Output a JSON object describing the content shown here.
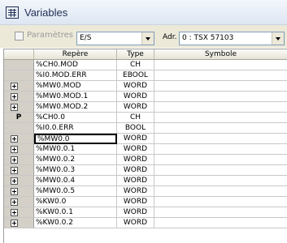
{
  "window": {
    "title": "Variables",
    "icon": "grid-icon"
  },
  "toolbar": {
    "params_label": "Paramètres",
    "type_select": {
      "value": "E/S"
    },
    "address_label": "Adr.",
    "address_select": {
      "value": "0 : TSX 57103"
    }
  },
  "table": {
    "columns": [
      "Repère",
      "Type",
      "Symbole"
    ],
    "rows": [
      {
        "marker": "",
        "repere": "%CH0.MOD",
        "type": "CH",
        "symbole": ""
      },
      {
        "marker": "",
        "repere": "%I0.MOD.ERR",
        "type": "EBOOL",
        "symbole": ""
      },
      {
        "marker": "plus",
        "repere": "%MW0.MOD",
        "type": "WORD",
        "symbole": ""
      },
      {
        "marker": "plus",
        "repere": "%MW0.MOD.1",
        "type": "WORD",
        "symbole": ""
      },
      {
        "marker": "plus",
        "repere": "%MW0.MOD.2",
        "type": "WORD",
        "symbole": ""
      },
      {
        "marker": "P",
        "repere": "%CH0.0",
        "type": "CH",
        "symbole": ""
      },
      {
        "marker": "",
        "repere": "%I0.0.ERR",
        "type": "BOOL",
        "symbole": ""
      },
      {
        "marker": "plus",
        "repere": "%MW0.0",
        "type": "WORD",
        "symbole": "",
        "active": true
      },
      {
        "marker": "plus",
        "repere": "%MW0.0.1",
        "type": "WORD",
        "symbole": ""
      },
      {
        "marker": "plus",
        "repere": "%MW0.0.2",
        "type": "WORD",
        "symbole": ""
      },
      {
        "marker": "plus",
        "repere": "%MW0.0.3",
        "type": "WORD",
        "symbole": ""
      },
      {
        "marker": "plus",
        "repere": "%MW0.0.4",
        "type": "WORD",
        "symbole": ""
      },
      {
        "marker": "plus",
        "repere": "%MW0.0.5",
        "type": "WORD",
        "symbole": ""
      },
      {
        "marker": "plus",
        "repere": "%KW0.0",
        "type": "WORD",
        "symbole": ""
      },
      {
        "marker": "plus",
        "repere": "%KW0.0.1",
        "type": "WORD",
        "symbole": ""
      },
      {
        "marker": "plus",
        "repere": "%KW0.0.2",
        "type": "WORD",
        "symbole": ""
      }
    ]
  }
}
